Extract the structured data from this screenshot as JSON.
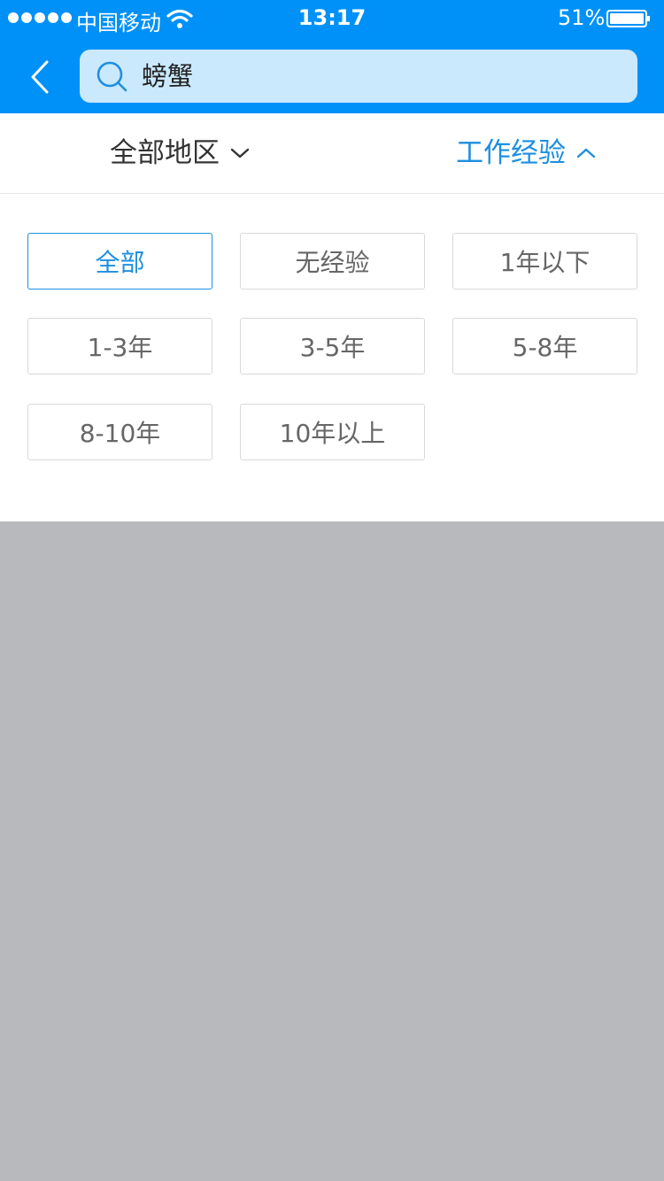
{
  "status": {
    "carrier": "中国移动",
    "time": "13:17",
    "battery": "51%"
  },
  "search": {
    "query": "螃蟹"
  },
  "filters": {
    "region_label": "全部地区",
    "experience_label": "工作经验"
  },
  "experience_options": [
    {
      "label": "全部",
      "selected": true
    },
    {
      "label": "无经验",
      "selected": false
    },
    {
      "label": "1年以下",
      "selected": false
    },
    {
      "label": "1-3年",
      "selected": false
    },
    {
      "label": "3-5年",
      "selected": false
    },
    {
      "label": "5-8年",
      "selected": false
    },
    {
      "label": "8-10年",
      "selected": false
    },
    {
      "label": "10年以上",
      "selected": false
    }
  ],
  "colors": {
    "brand": "#0091f8",
    "accent": "#1d8fe0",
    "search_bg": "#cbe9fd",
    "overlay": "#b8b9bd"
  }
}
